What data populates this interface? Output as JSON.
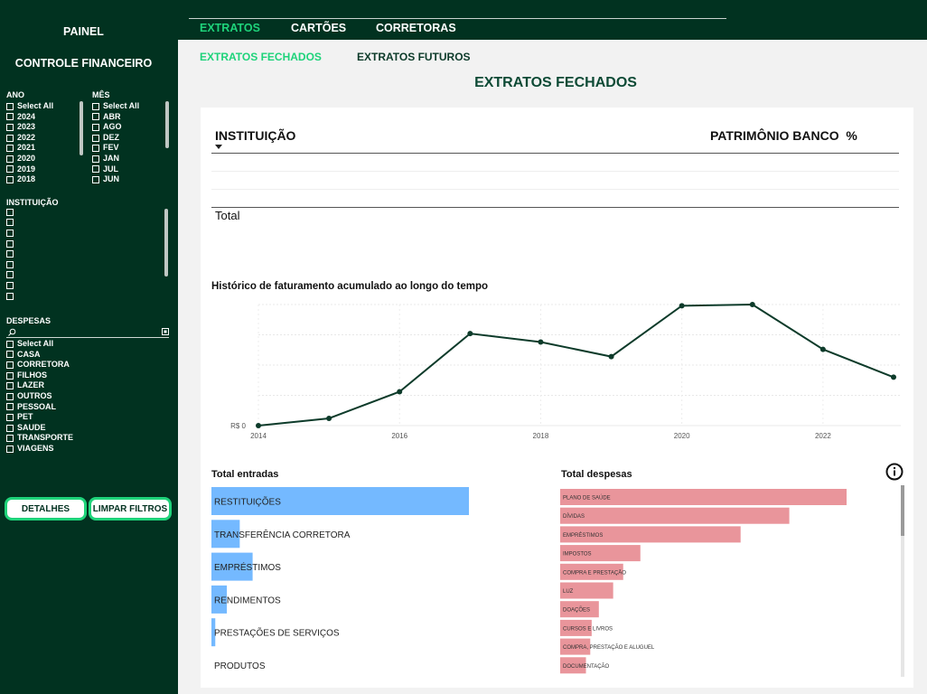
{
  "sidebar": {
    "title1": "PAINEL",
    "title2": "CONTROLE FINANCEIRO",
    "ano": {
      "label": "ANO",
      "items": [
        "Select All",
        "2024",
        "2023",
        "2022",
        "2021",
        "2020",
        "2019",
        "2018"
      ]
    },
    "mes": {
      "label": "MÊS",
      "items": [
        "Select All",
        "ABR",
        "AGO",
        "DEZ",
        "FEV",
        "JAN",
        "JUL",
        "JUN"
      ]
    },
    "instituicao": {
      "label": "INSTITUIÇÃO",
      "count": 9
    },
    "despesas": {
      "label": "DESPESAS",
      "items": [
        "Select All",
        "CASA",
        "CORRETORA",
        "FILHOS",
        "LAZER",
        "OUTROS",
        "PESSOAL",
        "PET",
        "SAUDE",
        "TRANSPORTE",
        "VIAGENS"
      ]
    },
    "buttons": {
      "detalhes": "DETALHES",
      "limpar": "LIMPAR FILTROS"
    }
  },
  "nav": {
    "tabs": [
      "EXTRATOS",
      "CARTÕES",
      "CORRETORAS"
    ],
    "subtabs": [
      "EXTRATOS FECHADOS",
      "EXTRATOS FUTUROS"
    ]
  },
  "page": {
    "title": "EXTRATOS FECHADOS"
  },
  "table": {
    "col1": "INSTITUIÇÃO",
    "col2": "PATRIMÔNIO BANCO",
    "col3": "%",
    "total": "Total"
  },
  "colors": {
    "dark": "#013220",
    "accent": "#1ed37a",
    "line": "#0d3b2a",
    "blue": "#74b9ff",
    "red": "#e9959b"
  },
  "chart_data": [
    {
      "type": "line",
      "title": "Histórico de faturamento acumulado ao longo do tempo",
      "x_ticks": [
        "2014",
        "2016",
        "2018",
        "2020",
        "2022"
      ],
      "y_tick_label": "R$ 0",
      "x": [
        2014,
        2015,
        2016,
        2017,
        2018,
        2019,
        2020,
        2021,
        2022,
        2023
      ],
      "values": [
        0,
        0.06,
        0.28,
        0.76,
        0.69,
        0.57,
        0.99,
        1.0,
        0.63,
        0.4
      ],
      "xlim": [
        2014,
        2023
      ],
      "ylim": [
        0,
        1.0
      ],
      "grid": true
    },
    {
      "type": "bar",
      "title": "Total entradas",
      "categories": [
        "RESTITUIÇÕES",
        "TRANSFERÊNCIA CORRETORA",
        "EMPRÉSTIMOS",
        "RENDIMENTOS",
        "PRESTAÇÕES DE SERVIÇOS",
        "PRODUTOS"
      ],
      "values": [
        100,
        11,
        16,
        6,
        1.5,
        0
      ]
    },
    {
      "type": "bar",
      "title": "Total despesas",
      "categories": [
        "PLANO DE SAÚDE",
        "DÍVIDAS",
        "EMPRÉSTIMOS",
        "IMPOSTOS",
        "COMPRA E PRESTAÇÃO",
        "LUZ",
        "DOAÇÕES",
        "CURSOS E LIVROS",
        "COMPRA, PRESTAÇÃO E ALUGUEL",
        "DOCUMENTAÇÃO"
      ],
      "values": [
        100,
        80,
        63,
        28,
        22,
        18.5,
        13.5,
        11,
        10.5,
        9
      ]
    }
  ]
}
